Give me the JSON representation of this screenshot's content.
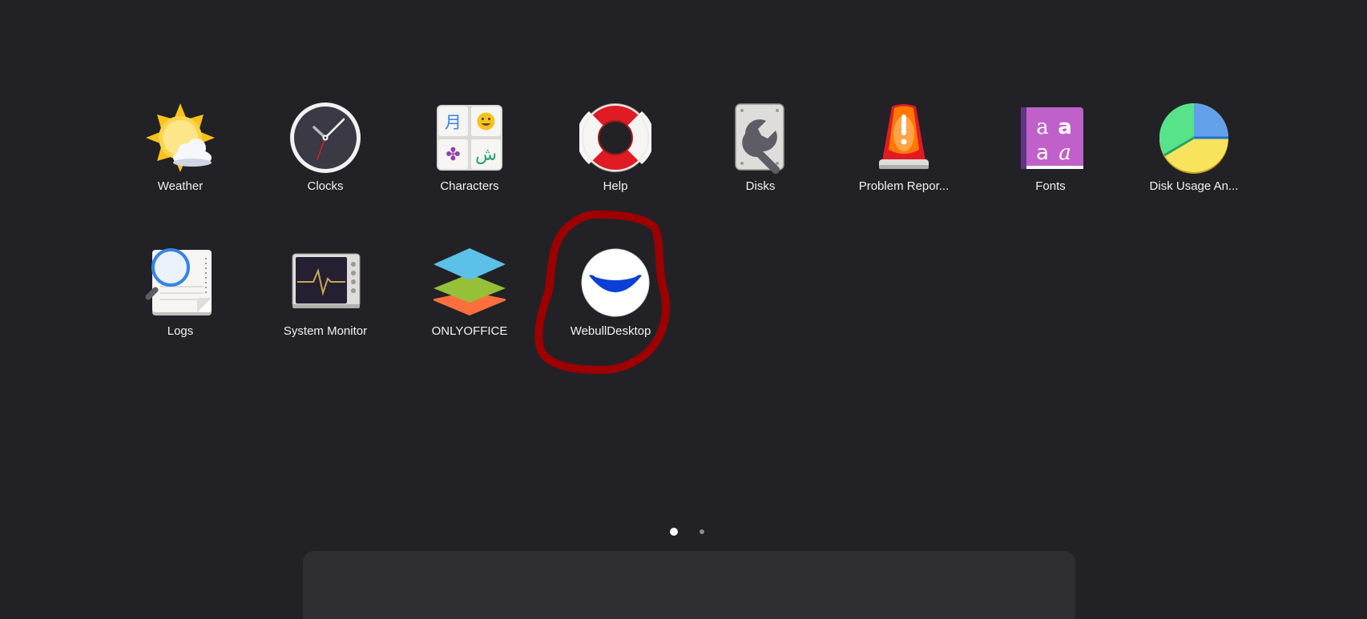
{
  "apps": [
    {
      "id": "weather",
      "label": "Weather",
      "icon": "weather-icon"
    },
    {
      "id": "clocks",
      "label": "Clocks",
      "icon": "clock-icon"
    },
    {
      "id": "characters",
      "label": "Characters",
      "icon": "characters-icon",
      "glyphs": [
        "月",
        "😀",
        "✤",
        "ش"
      ]
    },
    {
      "id": "help",
      "label": "Help",
      "icon": "lifebuoy-icon"
    },
    {
      "id": "disks",
      "label": "Disks",
      "icon": "disk-wrench-icon"
    },
    {
      "id": "problem-reporting",
      "label": "Problem Repor...",
      "icon": "alarm-siren-icon"
    },
    {
      "id": "fonts",
      "label": "Fonts",
      "icon": "fonts-book-icon",
      "glyphs": [
        "a",
        "a",
        "a",
        "a"
      ]
    },
    {
      "id": "disk-usage",
      "label": "Disk Usage An...",
      "icon": "pie-chart-icon"
    },
    {
      "id": "logs",
      "label": "Logs",
      "icon": "logs-magnifier-icon"
    },
    {
      "id": "system-monitor",
      "label": "System Monitor",
      "icon": "system-monitor-icon"
    },
    {
      "id": "onlyoffice",
      "label": "ONLYOFFICE",
      "icon": "onlyoffice-layers-icon"
    },
    {
      "id": "webull",
      "label": "WebullDesktop",
      "icon": "webull-logo-icon"
    }
  ],
  "pagination": {
    "pages": 2,
    "current": 1
  },
  "colors": {
    "background": "#222226",
    "annotation_stroke": "#9e0000",
    "webull_blue": "#0b3fd6"
  }
}
